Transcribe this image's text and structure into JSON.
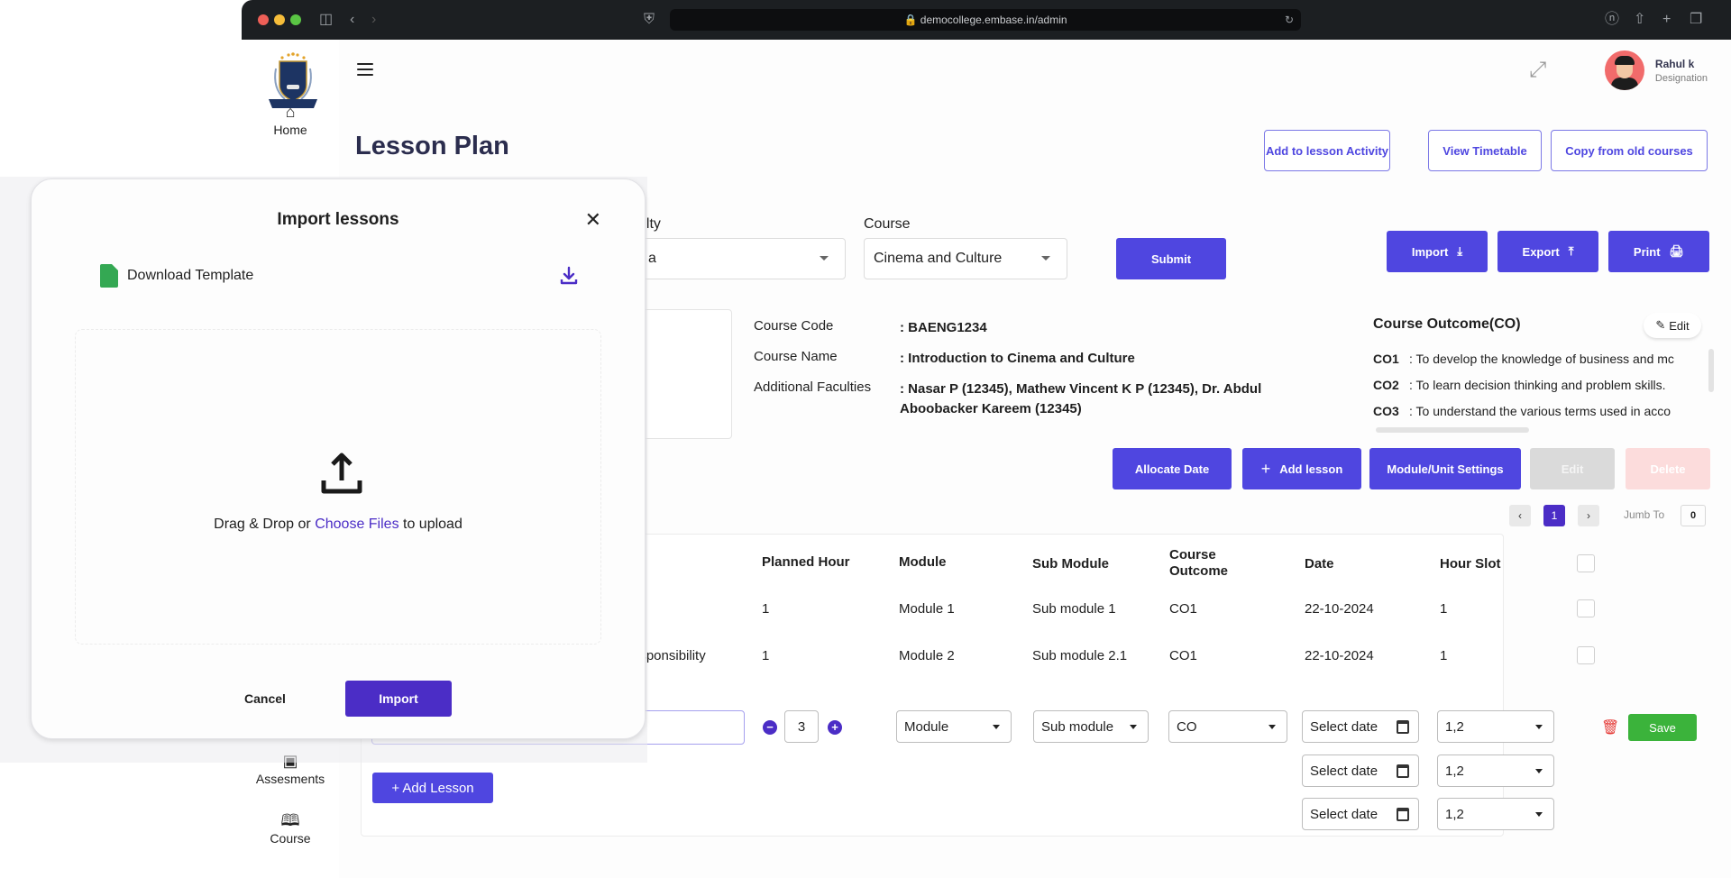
{
  "browser": {
    "url": "democollege.embase.in/admin"
  },
  "sidebar": {
    "items": [
      {
        "label": "Home",
        "icon": "home-icon"
      },
      {
        "label": "Assesments",
        "icon": "clipboard-icon"
      },
      {
        "label": "Course",
        "icon": "book-icon"
      }
    ]
  },
  "header": {
    "title": "Lesson Plan",
    "user_name": "Rahul k",
    "user_role": "Designation"
  },
  "top_actions": {
    "add_to_activity": "Add to lesson Activity",
    "view_timetable": "View Timetable",
    "copy_old": "Copy from old courses"
  },
  "filters": {
    "faculty_label": "ulty",
    "faculty_value": "a",
    "course_label": "Course",
    "course_value": "Cinema and Culture",
    "submit": "Submit"
  },
  "io_actions": {
    "import": "Import",
    "export": "Export",
    "print": "Print"
  },
  "course_info": {
    "code_label": "Course Code",
    "code_value": ": BAENG1234",
    "name_label": "Course Name",
    "name_value": ": Introduction to Cinema and Culture",
    "faculties_label": "Additional Faculties",
    "faculties_value": ": Nasar P (12345), Mathew Vincent K P (12345), Dr. Abdul Aboobacker Kareem (12345)"
  },
  "course_outcome": {
    "title": "Course Outcome(CO)",
    "edit": "Edit",
    "items": [
      {
        "code": "CO1",
        "text": ": To develop the knowledge of business and mc"
      },
      {
        "code": "CO2",
        "text": ": To learn decision thinking and problem skills."
      },
      {
        "code": "CO3",
        "text": ": To understand the various terms used in acco"
      }
    ]
  },
  "lesson_actions": {
    "allocate": "Allocate Date",
    "add_lesson": "Add lesson",
    "module_settings": "Module/Unit Settings",
    "edit": "Edit",
    "delete": "Delete"
  },
  "pagination": {
    "current": "1",
    "jump_label": "Jumb To",
    "jump_value": "0"
  },
  "table": {
    "headers": [
      "Planned Hour",
      "Module",
      "Sub Module",
      "Course Outcome",
      "Date",
      "Hour Slot"
    ],
    "rows": [
      {
        "lesson": "",
        "planned_hour": "1",
        "module": "Module 1",
        "sub_module": "Sub module 1",
        "co": "CO1",
        "date": "22-10-2024",
        "hour_slot": "1"
      },
      {
        "lesson": "esponsibility",
        "planned_hour": "1",
        "module": "Module 2",
        "sub_module": "Sub module 2.1",
        "co": "CO1",
        "date": "22-10-2024",
        "hour_slot": "1"
      }
    ],
    "edit_row": {
      "hours": "3",
      "module_placeholder": "Module",
      "sub_module_placeholder": "Sub module",
      "co_placeholder": "CO",
      "date_placeholder": "Select date",
      "hour_slot": "1,2",
      "save": "Save"
    },
    "add_lesson": "+ Add Lesson"
  },
  "modal": {
    "title": "Import lessons",
    "template_label": "Download Template",
    "drop_prefix": "Drag & Drop or ",
    "drop_link": "Choose Files",
    "drop_suffix": " to upload",
    "cancel": "Cancel",
    "import": "Import"
  },
  "colors": {
    "primary": "#4f46e0",
    "modal_primary": "#4b2dc6",
    "save": "#3bb33b",
    "danger": "#e53935"
  }
}
